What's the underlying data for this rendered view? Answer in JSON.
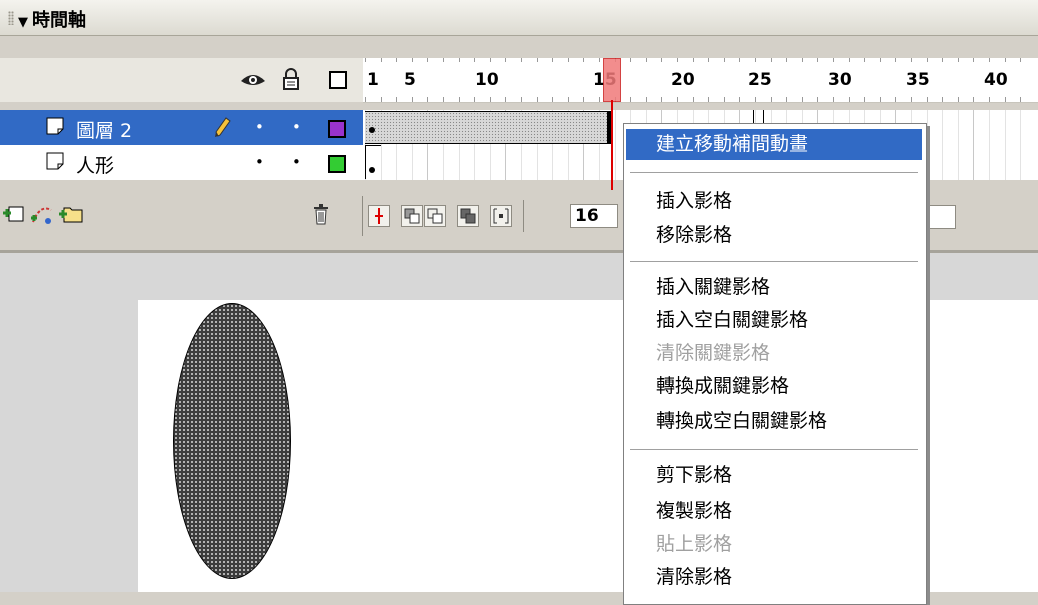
{
  "panel": {
    "title": "時間軸",
    "collapse_glyph": "▼"
  },
  "header_icons": {
    "show_hide": "eye-icon",
    "lock": "lock-icon",
    "outline": "outline-square-icon"
  },
  "ruler": {
    "labels": [
      "1",
      "5",
      "10",
      "15",
      "20",
      "25",
      "30",
      "35",
      "40"
    ],
    "current_frame": 15
  },
  "layers": [
    {
      "name": "圖層 2",
      "selected": true,
      "editing_icon": "pencil-icon",
      "visible_dot": "•",
      "lock_dot": "•",
      "outline_color": "#9933cc"
    },
    {
      "name": "人形",
      "selected": false,
      "visible_dot": "•",
      "lock_dot": "•",
      "outline_color": "#33cc33"
    }
  ],
  "toolbar": {
    "left_icons": [
      "insert-layer-icon",
      "add-motion-guide-icon",
      "insert-layer-folder-icon"
    ],
    "delete_icon": "trash-icon",
    "right_icons": [
      "center-frame-icon",
      "onion-skin-icon",
      "onion-skin-outlines-icon",
      "edit-multiple-frames-icon",
      "modify-onion-markers-icon"
    ],
    "current_frame_value": "16"
  },
  "context_menu": {
    "groups": [
      [
        {
          "label": "建立移動補間動畫",
          "active": true,
          "disabled": false
        }
      ],
      [
        {
          "label": "插入影格",
          "disabled": false
        },
        {
          "label": "移除影格",
          "disabled": false
        }
      ],
      [
        {
          "label": "插入關鍵影格",
          "disabled": false
        },
        {
          "label": "插入空白關鍵影格",
          "disabled": false
        },
        {
          "label": "清除關鍵影格",
          "disabled": true
        },
        {
          "label": "轉換成關鍵影格",
          "disabled": false
        },
        {
          "label": "轉換成空白關鍵影格",
          "disabled": false
        }
      ],
      [
        {
          "label": "剪下影格",
          "disabled": false
        },
        {
          "label": "複製影格",
          "disabled": false
        },
        {
          "label": "貼上影格",
          "disabled": true
        },
        {
          "label": "清除影格",
          "disabled": false
        }
      ]
    ]
  },
  "colors": {
    "selection": "#316ac5",
    "playhead": "#d00000"
  }
}
